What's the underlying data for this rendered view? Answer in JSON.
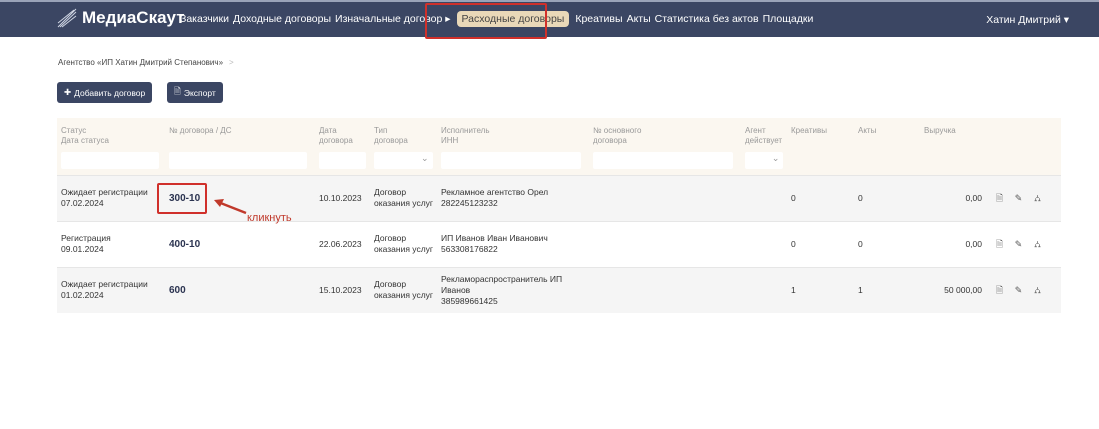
{
  "nav": {
    "brand": "МедиаСкаут",
    "items": [
      "Заказчики",
      "Доходные договоры",
      "Изначальные договор ▸",
      "Расходные договоры",
      "Креативы",
      "Акты",
      "Статистика без актов",
      "Площадки"
    ],
    "active_index": 3,
    "user": "Хатин Дмитрий ▾"
  },
  "breadcrumb": {
    "item": "Агентство «ИП Хатин Дмитрий Степанович»",
    "sep": ">"
  },
  "toolbar": {
    "add": "Добавить договор",
    "export": "Экспорт"
  },
  "table": {
    "headers": [
      [
        "Статус",
        "Дата статуса"
      ],
      [
        "№ договора / ДС",
        ""
      ],
      [
        "Дата",
        "договора"
      ],
      [
        "Тип",
        "договора"
      ],
      [
        "Исполнитель",
        "ИНН"
      ],
      [
        "№ основного",
        "договора"
      ],
      [
        "Агент",
        "действует"
      ],
      [
        "Креативы",
        ""
      ],
      [
        "Акты",
        ""
      ],
      [
        "Выручка",
        ""
      ]
    ],
    "rows": [
      {
        "status": "Ожидает регистрации",
        "status_date": "07.02.2024",
        "num": "300-10",
        "date": "10.10.2023",
        "type1": "Договор",
        "type2": "оказания услуг",
        "exec": "Рекламное агентство Орел",
        "inn": "282245123232",
        "main": "",
        "agent": "",
        "creatives": "0",
        "acts": "0",
        "revenue": "0,00"
      },
      {
        "status": "Регистрация",
        "status_date": "09.01.2024",
        "num": "400-10",
        "date": "22.06.2023",
        "type1": "Договор",
        "type2": "оказания услуг",
        "exec": "ИП Иванов Иван Иванович",
        "inn": "563308176822",
        "main": "",
        "agent": "",
        "creatives": "0",
        "acts": "0",
        "revenue": "0,00"
      },
      {
        "status": "Ожидает регистрации",
        "status_date": "01.02.2024",
        "num": "600",
        "date": "15.10.2023",
        "type1": "Договор",
        "type2": "оказания услуг",
        "exec": "Рекламораспространитель ИП Иванов",
        "inn": "385989661425",
        "main": "",
        "agent": "",
        "creatives": "1",
        "acts": "1",
        "revenue": "50 000,00"
      }
    ]
  },
  "annotation": {
    "text": "кликнуть",
    "color": "#d0302b"
  }
}
